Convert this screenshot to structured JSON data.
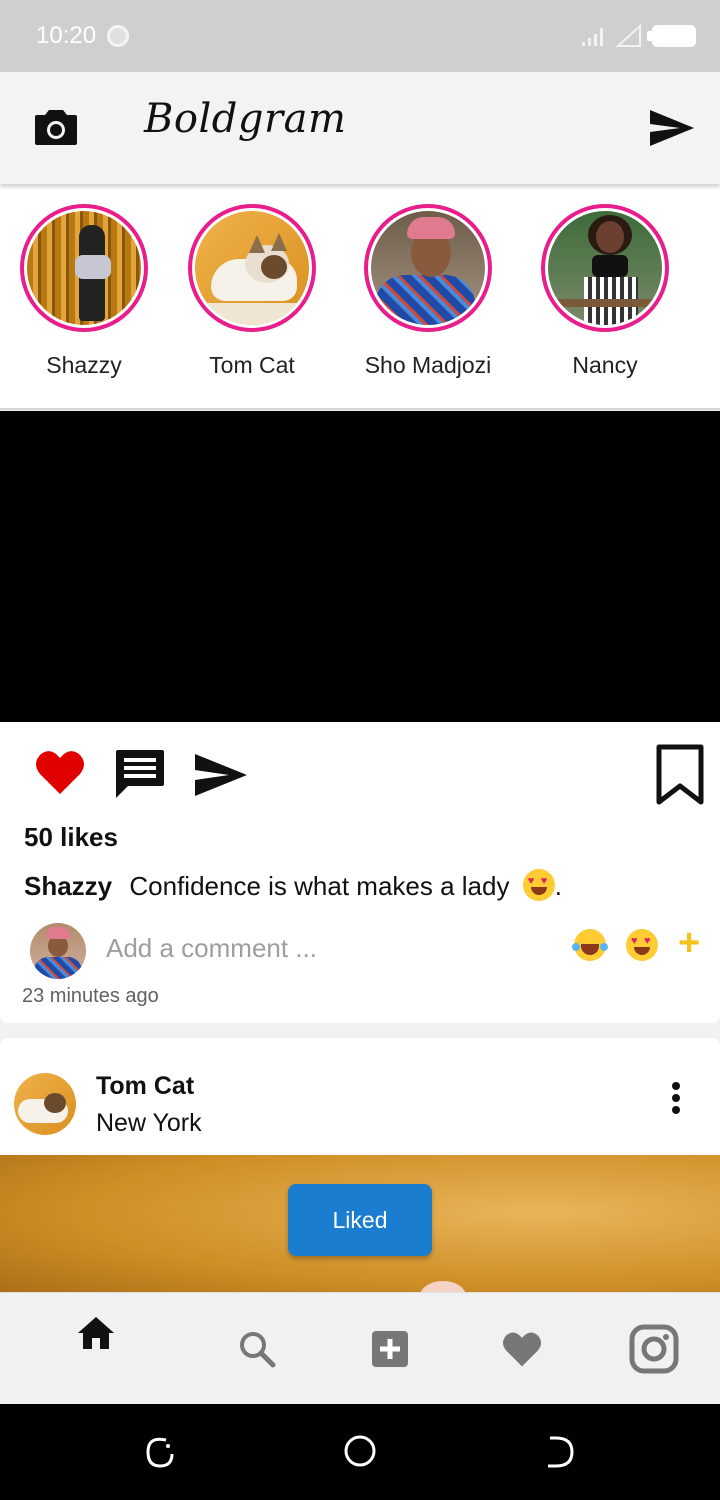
{
  "status_bar": {
    "time": "10:20"
  },
  "header": {
    "brand": "Boldgram",
    "camera_icon": "camera-icon",
    "send_icon": "send-icon"
  },
  "stories": [
    {
      "name": "Shazzy"
    },
    {
      "name": "Tom Cat"
    },
    {
      "name": "Sho Madjozi"
    },
    {
      "name": "Nancy"
    }
  ],
  "post1": {
    "likes": "50 likes",
    "author": "Shazzy",
    "caption": "Confidence is what makes a lady",
    "caption_end": ".",
    "comment_placeholder": "Add a comment ...",
    "time_ago": "23 minutes ago",
    "liked": true
  },
  "post2": {
    "author": "Tom Cat",
    "location": "New York"
  },
  "toast": {
    "label": "Liked"
  },
  "bottom_nav": [
    "home-icon",
    "search-icon",
    "add-icon",
    "heart-icon",
    "instagram-icon"
  ],
  "colors": {
    "story_ring": "#e91e8c",
    "like_red": "#e00000",
    "toast_blue": "#1a7dd0",
    "emoji_plus": "#f6c21a"
  }
}
